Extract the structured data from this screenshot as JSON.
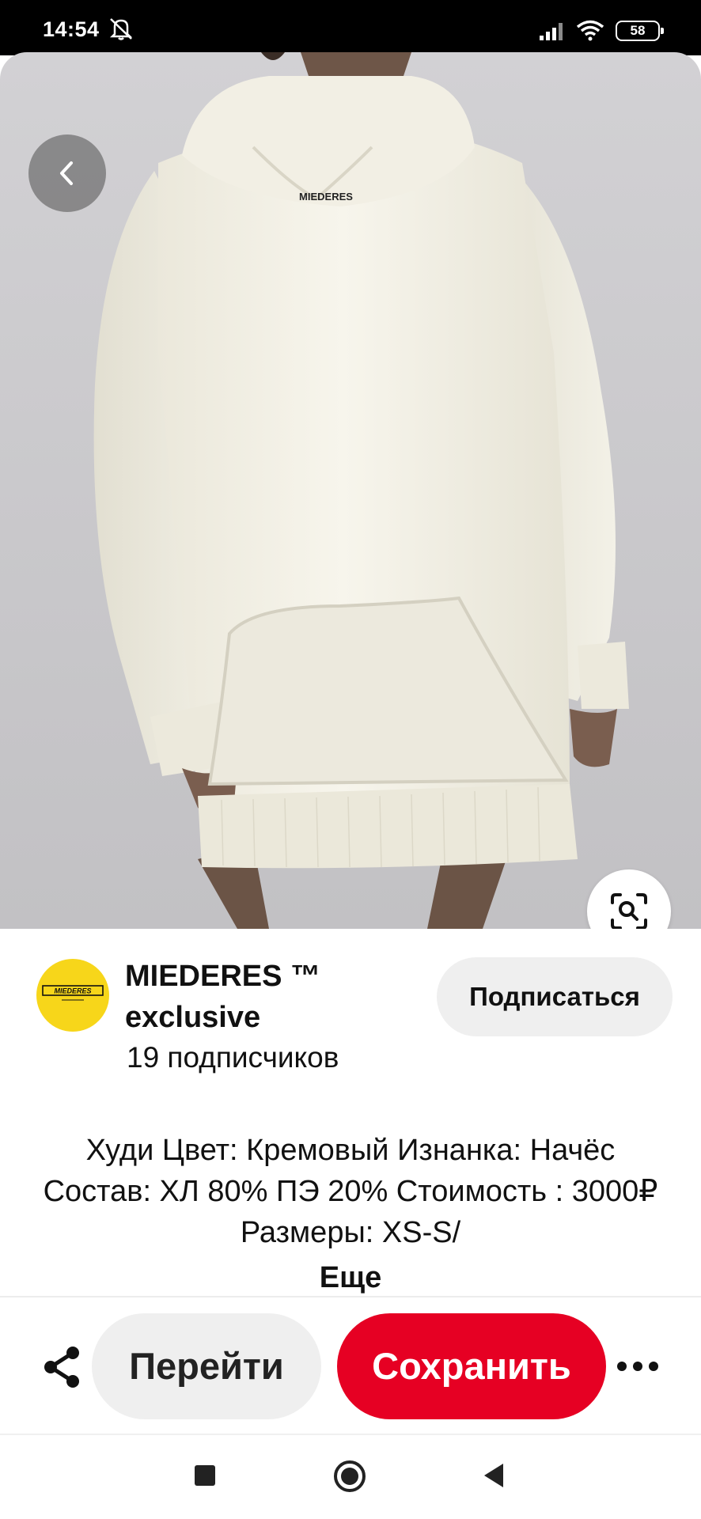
{
  "status_bar": {
    "time": "14:54",
    "battery": "58",
    "icons": [
      "do-not-disturb-icon",
      "signal-icon",
      "wifi-icon",
      "battery-icon"
    ]
  },
  "pin": {
    "image_description": "cream oversized hoodie with kangaroo pocket",
    "garment_logo": "MIEDERES",
    "colors": {
      "background": "#c9c8cb",
      "hoodie": "#f4f1e6",
      "save_red": "#e60023",
      "avatar_yellow": "#f7d61a"
    }
  },
  "creator": {
    "avatar_logo": "MIEDERES",
    "name": "MIEDERES ™ exclusive",
    "followers": "19 подписчиков",
    "follow_label": "Подписаться"
  },
  "description": {
    "text": "Худи Цвет: Кремовый Изнанка: Начёс Состав: ХЛ 80% ПЭ 20% Стоимость : 3000₽ Размеры: XS-S/",
    "more_label": "Еще"
  },
  "actions": {
    "visit_label": "Перейти",
    "save_label": "Сохранить"
  },
  "nav": {
    "icons": [
      "recents-icon",
      "home-icon",
      "back-icon"
    ]
  }
}
